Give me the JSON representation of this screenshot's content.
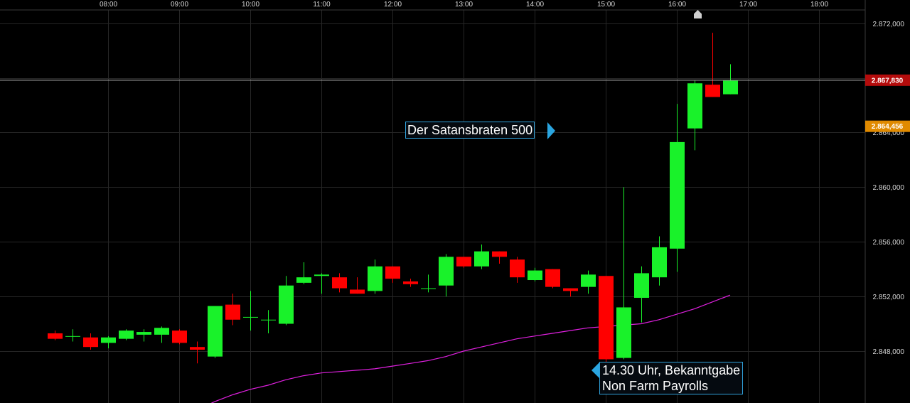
{
  "chart_data": {
    "type": "candlestick",
    "x_ticks": [
      "08:00",
      "09:00",
      "10:00",
      "11:00",
      "12:00",
      "13:00",
      "14:00",
      "15:00",
      "16:00",
      "17:00",
      "18:00"
    ],
    "y_ticks": [
      "2.872,000",
      "2.868,000",
      "2.864,000",
      "2.860,000",
      "2.856,000",
      "2.852,000",
      "2.848,000"
    ],
    "y_tick_values": [
      2872,
      2868,
      2864,
      2860,
      2856,
      2852,
      2848
    ],
    "ylim": [
      2844.2,
      2873.7
    ],
    "grid": true,
    "candle_interval_minutes": 15,
    "candles": [
      {
        "time": "07:15",
        "open": 2849.3,
        "high": 2849.5,
        "low": 2848.8,
        "close": 2848.9
      },
      {
        "time": "07:30",
        "open": 2849.1,
        "high": 2849.6,
        "low": 2848.7,
        "close": 2849.1
      },
      {
        "time": "07:45",
        "open": 2849.0,
        "high": 2849.3,
        "low": 2848.1,
        "close": 2848.3
      },
      {
        "time": "08:00",
        "open": 2848.6,
        "high": 2849.1,
        "low": 2848.2,
        "close": 2849.0
      },
      {
        "time": "08:15",
        "open": 2848.9,
        "high": 2849.6,
        "low": 2848.8,
        "close": 2849.5
      },
      {
        "time": "08:30",
        "open": 2849.2,
        "high": 2849.6,
        "low": 2848.7,
        "close": 2849.4
      },
      {
        "time": "08:45",
        "open": 2849.2,
        "high": 2849.8,
        "low": 2848.6,
        "close": 2849.7
      },
      {
        "time": "09:00",
        "open": 2849.5,
        "high": 2849.6,
        "low": 2848.5,
        "close": 2848.6
      },
      {
        "time": "09:15",
        "open": 2848.3,
        "high": 2848.7,
        "low": 2847.1,
        "close": 2848.1
      },
      {
        "time": "09:30",
        "open": 2847.6,
        "high": 2851.3,
        "low": 2847.5,
        "close": 2851.3
      },
      {
        "time": "09:45",
        "open": 2851.4,
        "high": 2852.2,
        "low": 2849.9,
        "close": 2850.3
      },
      {
        "time": "10:00",
        "open": 2850.5,
        "high": 2852.4,
        "low": 2849.5,
        "close": 2850.5
      },
      {
        "time": "10:15",
        "open": 2850.3,
        "high": 2851.0,
        "low": 2849.3,
        "close": 2850.3
      },
      {
        "time": "10:30",
        "open": 2850.0,
        "high": 2853.5,
        "low": 2849.9,
        "close": 2852.8
      },
      {
        "time": "10:45",
        "open": 2853.0,
        "high": 2854.5,
        "low": 2852.9,
        "close": 2853.4
      },
      {
        "time": "11:00",
        "open": 2853.5,
        "high": 2853.7,
        "low": 2852.2,
        "close": 2853.6
      },
      {
        "time": "11:15",
        "open": 2853.4,
        "high": 2853.7,
        "low": 2852.3,
        "close": 2852.6
      },
      {
        "time": "11:30",
        "open": 2852.5,
        "high": 2853.4,
        "low": 2852.2,
        "close": 2852.2
      },
      {
        "time": "11:45",
        "open": 2852.4,
        "high": 2854.7,
        "low": 2852.2,
        "close": 2854.2
      },
      {
        "time": "12:00",
        "open": 2854.2,
        "high": 2854.2,
        "low": 2853.0,
        "close": 2853.3
      },
      {
        "time": "12:15",
        "open": 2853.1,
        "high": 2853.3,
        "low": 2852.7,
        "close": 2852.9
      },
      {
        "time": "12:30",
        "open": 2852.6,
        "high": 2853.6,
        "low": 2852.3,
        "close": 2852.6
      },
      {
        "time": "12:45",
        "open": 2852.8,
        "high": 2855.1,
        "low": 2852.0,
        "close": 2854.9
      },
      {
        "time": "13:00",
        "open": 2854.9,
        "high": 2854.9,
        "low": 2854.1,
        "close": 2854.2
      },
      {
        "time": "13:15",
        "open": 2854.2,
        "high": 2855.8,
        "low": 2854.0,
        "close": 2855.3
      },
      {
        "time": "13:30",
        "open": 2855.3,
        "high": 2855.3,
        "low": 2854.4,
        "close": 2854.9
      },
      {
        "time": "13:45",
        "open": 2854.7,
        "high": 2854.9,
        "low": 2853.0,
        "close": 2853.4
      },
      {
        "time": "14:00",
        "open": 2853.2,
        "high": 2854.1,
        "low": 2853.1,
        "close": 2853.9
      },
      {
        "time": "14:15",
        "open": 2854.0,
        "high": 2854.0,
        "low": 2852.6,
        "close": 2852.7
      },
      {
        "time": "14:30",
        "open": 2852.6,
        "high": 2852.6,
        "low": 2852.0,
        "close": 2852.4
      },
      {
        "time": "14:45",
        "open": 2852.7,
        "high": 2853.9,
        "low": 2852.2,
        "close": 2853.6
      },
      {
        "time": "15:00",
        "open": 2853.5,
        "high": 2853.5,
        "low": 2846.1,
        "close": 2847.4
      },
      {
        "time": "15:15",
        "open": 2847.5,
        "high": 2860.0,
        "low": 2847.4,
        "close": 2851.2
      },
      {
        "time": "15:30",
        "open": 2851.9,
        "high": 2854.2,
        "low": 2850.1,
        "close": 2853.7
      },
      {
        "time": "15:45",
        "open": 2853.4,
        "high": 2856.4,
        "low": 2852.8,
        "close": 2855.6
      },
      {
        "time": "16:00",
        "open": 2855.5,
        "high": 2866.1,
        "low": 2853.8,
        "close": 2863.3
      },
      {
        "time": "16:15",
        "open": 2864.3,
        "high": 2867.8,
        "low": 2862.7,
        "close": 2867.6
      },
      {
        "time": "16:30",
        "open": 2867.5,
        "high": 2871.3,
        "low": 2866.6,
        "close": 2866.6
      },
      {
        "time": "16:45",
        "open": 2866.8,
        "high": 2869.0,
        "low": 2866.8,
        "close": 2867.8
      }
    ],
    "series": [
      {
        "values_by_time": [
          [
            "09:15",
            2843.7
          ],
          [
            "09:30",
            2844.3
          ],
          [
            "09:45",
            2844.8
          ],
          [
            "10:00",
            2845.2
          ],
          [
            "10:15",
            2845.5
          ],
          [
            "10:30",
            2845.9
          ],
          [
            "10:45",
            2846.2
          ],
          [
            "11:00",
            2846.4
          ],
          [
            "11:15",
            2846.5
          ],
          [
            "11:30",
            2846.6
          ],
          [
            "11:45",
            2846.7
          ],
          [
            "12:00",
            2846.9
          ],
          [
            "12:15",
            2847.1
          ],
          [
            "12:30",
            2847.3
          ],
          [
            "12:45",
            2847.6
          ],
          [
            "13:00",
            2848.0
          ],
          [
            "13:15",
            2848.3
          ],
          [
            "13:30",
            2848.6
          ],
          [
            "13:45",
            2848.9
          ],
          [
            "14:00",
            2849.1
          ],
          [
            "14:15",
            2849.3
          ],
          [
            "14:30",
            2849.5
          ],
          [
            "14:45",
            2849.7
          ],
          [
            "15:00",
            2849.8
          ],
          [
            "15:15",
            2849.9
          ],
          [
            "15:30",
            2850.0
          ],
          [
            "15:45",
            2850.3
          ],
          [
            "16:00",
            2850.7
          ],
          [
            "16:15",
            2851.1
          ],
          [
            "16:30",
            2851.6
          ],
          [
            "16:45",
            2852.1
          ]
        ]
      }
    ],
    "last_price_label": "2.867,830",
    "last_price_value": 2867.83,
    "marker_label": "2.864,456",
    "marker_value": 2864.456,
    "annotations": [
      {
        "lines": [
          "Der Satansbraten 500"
        ],
        "pointer": "right"
      },
      {
        "lines": [
          "14.30 Uhr, Bekanntgabe",
          "Non Farm Payrolls"
        ],
        "pointer": "left"
      }
    ],
    "colors": {
      "up": "#19f22a",
      "down": "#ff0000",
      "moving_average": "#e020e0",
      "grid": "#262626",
      "last_price_line": "#b0b0b0",
      "last_price_tag": "#b40c0c",
      "marker_tag": "#e08a00",
      "callout_border": "#2f9fd8"
    }
  }
}
